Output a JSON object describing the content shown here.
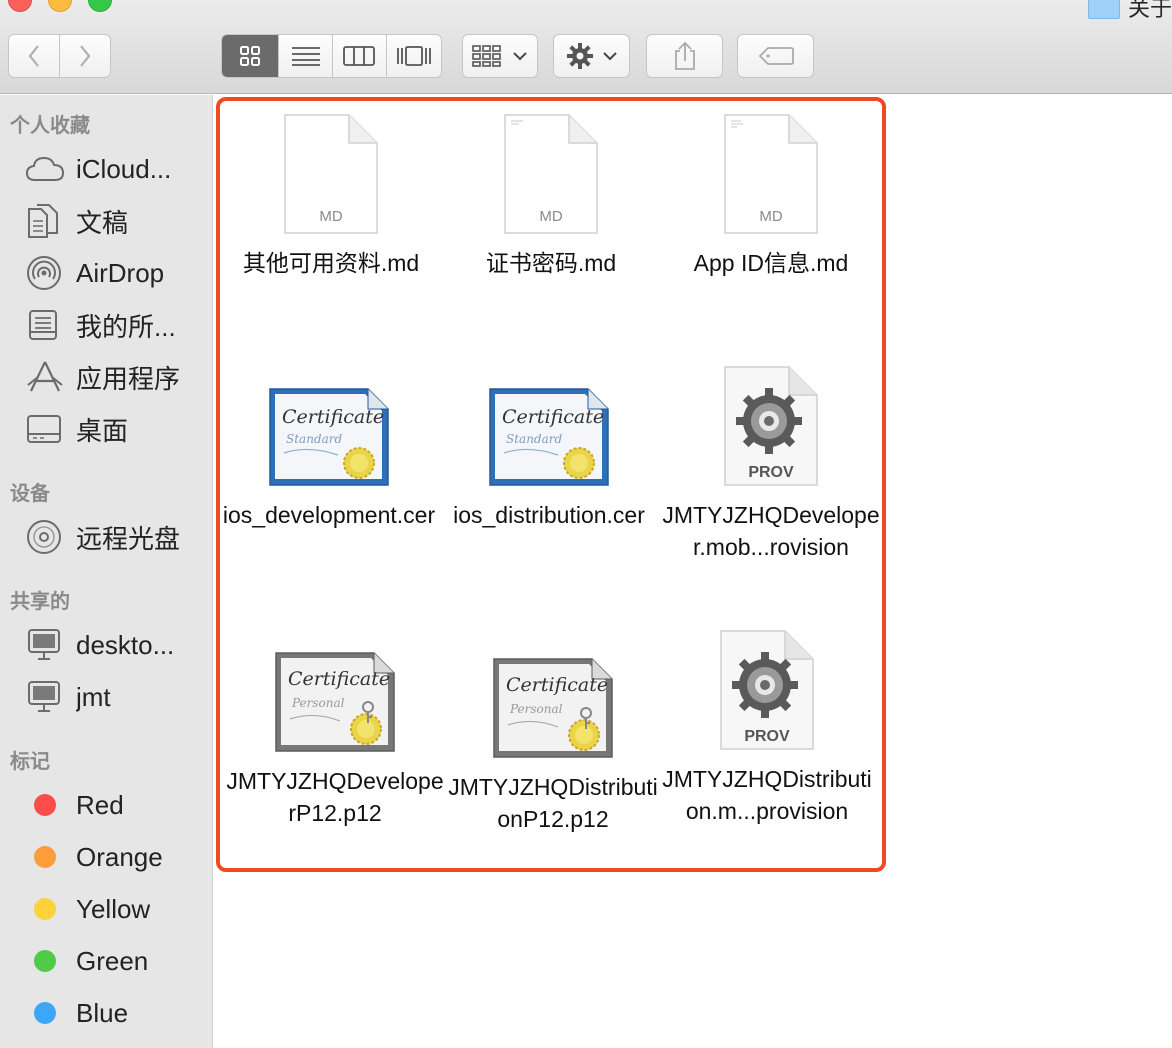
{
  "window": {
    "title": "关于",
    "traffic_lights": [
      "close",
      "minimize",
      "maximize"
    ]
  },
  "toolbar": {
    "back_icon": "chevron-left-icon",
    "forward_icon": "chevron-right-icon",
    "view_modes": [
      "icon-view",
      "list-view",
      "column-view",
      "cover-flow-view"
    ],
    "active_view": "icon-view",
    "arrange_icon": "arrange-grid-icon",
    "action_icon": "gear-icon",
    "share_icon": "share-icon",
    "tag_icon": "tag-icon"
  },
  "sidebar": {
    "favorites_label": "个人收藏",
    "favorites": [
      {
        "label": "iCloud...",
        "icon": "cloud-icon"
      },
      {
        "label": "文稿",
        "icon": "documents-icon"
      },
      {
        "label": "AirDrop",
        "icon": "airdrop-icon"
      },
      {
        "label": "我的所...",
        "icon": "all-files-icon"
      },
      {
        "label": "应用程序",
        "icon": "applications-icon"
      },
      {
        "label": "桌面",
        "icon": "desktop-icon"
      }
    ],
    "devices_label": "设备",
    "devices": [
      {
        "label": "远程光盘",
        "icon": "disc-icon"
      }
    ],
    "shared_label": "共享的",
    "shared": [
      {
        "label": "deskto...",
        "icon": "computer-icon"
      },
      {
        "label": "jmt",
        "icon": "computer-icon"
      }
    ],
    "tags_label": "标记",
    "tags": [
      {
        "label": "Red",
        "color": "#fc4d4a"
      },
      {
        "label": "Orange",
        "color": "#fd9d3a"
      },
      {
        "label": "Yellow",
        "color": "#fdd339"
      },
      {
        "label": "Green",
        "color": "#4fcb47"
      },
      {
        "label": "Blue",
        "color": "#3ca7f6"
      }
    ]
  },
  "files": [
    {
      "name": "其他可用资料.md",
      "type": "md",
      "badge": "MD"
    },
    {
      "name": "证书密码.md",
      "type": "md",
      "badge": "MD"
    },
    {
      "name": "App ID信息.md",
      "type": "md",
      "badge": "MD"
    },
    {
      "name": "ios_development.cer",
      "type": "cert-standard",
      "badge": ""
    },
    {
      "name": "ios_distribution.cer",
      "type": "cert-standard",
      "badge": ""
    },
    {
      "name": "JMTYJZHQDeveloper.mob...rovision",
      "type": "prov",
      "badge": "PROV"
    },
    {
      "name": "JMTYJZHQDeveloperP12.p12",
      "type": "cert-personal",
      "badge": ""
    },
    {
      "name": "JMTYJZHQDistributionP12.p12",
      "type": "cert-personal",
      "badge": ""
    },
    {
      "name": "JMTYJZHQDistribution.m...provision",
      "type": "prov",
      "badge": "PROV"
    }
  ],
  "icon_texts": {
    "cert_title": "Certificate",
    "cert_standard": "Standard",
    "cert_personal": "Personal"
  },
  "highlight_color": "#f04a25"
}
